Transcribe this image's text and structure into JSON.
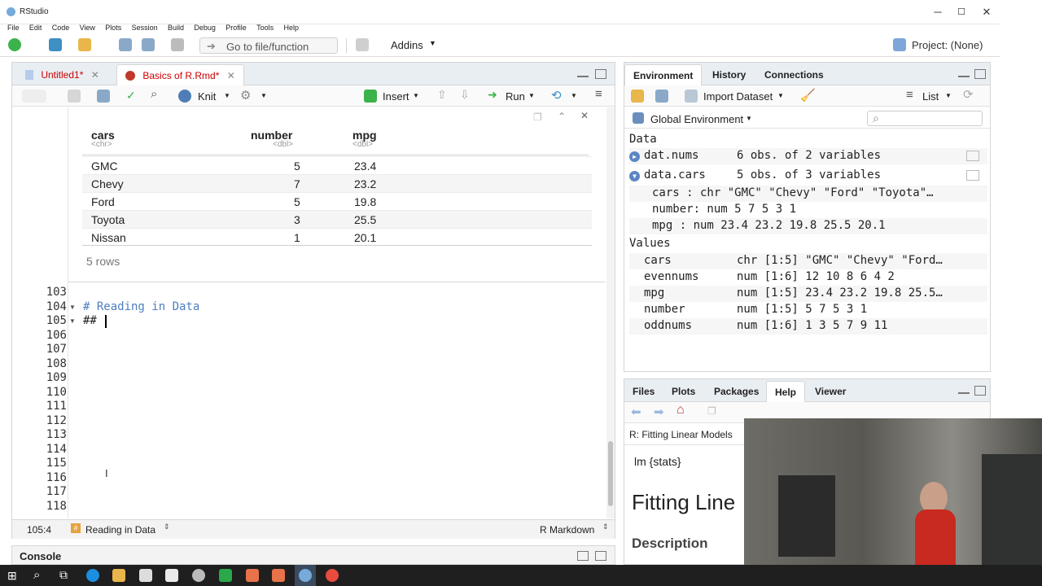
{
  "window": {
    "title": "RStudio",
    "minimize": "─",
    "maximize": "☐",
    "close": "✕"
  },
  "menu": [
    "File",
    "Edit",
    "Code",
    "View",
    "Plots",
    "Session",
    "Build",
    "Debug",
    "Profile",
    "Tools",
    "Help"
  ],
  "toolbar": {
    "goto_placeholder": "Go to file/function",
    "addins": "Addins",
    "project": "Project: (None)"
  },
  "editor": {
    "tabs": [
      {
        "label": "Untitled1*",
        "active": false
      },
      {
        "label": "Basics of R.Rmd*",
        "active": true
      }
    ],
    "toolbar": {
      "knit": "Knit",
      "insert": "Insert",
      "run": "Run"
    },
    "output": {
      "columns": [
        {
          "name": "cars",
          "type": "<chr>"
        },
        {
          "name": "number",
          "type": "<dbl>"
        },
        {
          "name": "mpg",
          "type": "<dbl>"
        }
      ],
      "rows": [
        [
          "GMC",
          "5",
          "23.4"
        ],
        [
          "Chevy",
          "7",
          "23.2"
        ],
        [
          "Ford",
          "5",
          "19.8"
        ],
        [
          "Toyota",
          "3",
          "25.5"
        ],
        [
          "Nissan",
          "1",
          "20.1"
        ]
      ],
      "row_count": "5 rows"
    },
    "lines": [
      {
        "num": "103",
        "text": ""
      },
      {
        "num": "104",
        "text": "# Reading in Data",
        "fold": true
      },
      {
        "num": "105",
        "text": "## ",
        "fold": true
      },
      {
        "num": "106",
        "text": ""
      },
      {
        "num": "107",
        "text": ""
      },
      {
        "num": "108",
        "text": ""
      },
      {
        "num": "109",
        "text": ""
      },
      {
        "num": "110",
        "text": ""
      },
      {
        "num": "111",
        "text": ""
      },
      {
        "num": "112",
        "text": ""
      },
      {
        "num": "113",
        "text": ""
      },
      {
        "num": "114",
        "text": ""
      },
      {
        "num": "115",
        "text": ""
      },
      {
        "num": "116",
        "text": ""
      },
      {
        "num": "117",
        "text": ""
      },
      {
        "num": "118",
        "text": ""
      }
    ],
    "status": {
      "position": "105:4",
      "section": "Reading in Data",
      "mode": "R Markdown"
    }
  },
  "console": {
    "label": "Console"
  },
  "environment": {
    "tabs": [
      "Environment",
      "History",
      "Connections"
    ],
    "toolbar": {
      "import": "Import Dataset",
      "view": "List"
    },
    "scope": "Global Environment",
    "data_header": "Data",
    "data": [
      {
        "name": "dat.nums",
        "value": "6 obs. of 2 variables",
        "expanded": false
      },
      {
        "name": "data.cars",
        "value": "5 obs. of 3 variables",
        "expanded": true
      }
    ],
    "data_cars_cols": [
      "cars : chr \"GMC\" \"Chevy\" \"Ford\" \"Toyota\"…",
      "number: num 5 7 5 3 1",
      "mpg : num 23.4 23.2 19.8 25.5 20.1"
    ],
    "values_header": "Values",
    "values": [
      {
        "name": "cars",
        "value": "chr [1:5] \"GMC\" \"Chevy\" \"Ford…"
      },
      {
        "name": "evennums",
        "value": "num [1:6] 12 10 8 6 4 2"
      },
      {
        "name": "mpg",
        "value": "num [1:5] 23.4 23.2 19.8 25.5…"
      },
      {
        "name": "number",
        "value": "num [1:5] 5 7 5 3 1"
      },
      {
        "name": "oddnums",
        "value": "num [1:6] 1 3 5 7 9 11"
      }
    ]
  },
  "files": {
    "tabs": [
      "Files",
      "Plots",
      "Packages",
      "Help",
      "Viewer"
    ],
    "help_topic": "R: Fitting Linear Models",
    "help_pkg": "lm {stats}",
    "help_title": "Fitting Line",
    "help_section": "Description"
  },
  "colors": {
    "accent": "#4d7fbf",
    "tabbar": "#e9eef3",
    "taskbar": "#1f1f1f"
  }
}
